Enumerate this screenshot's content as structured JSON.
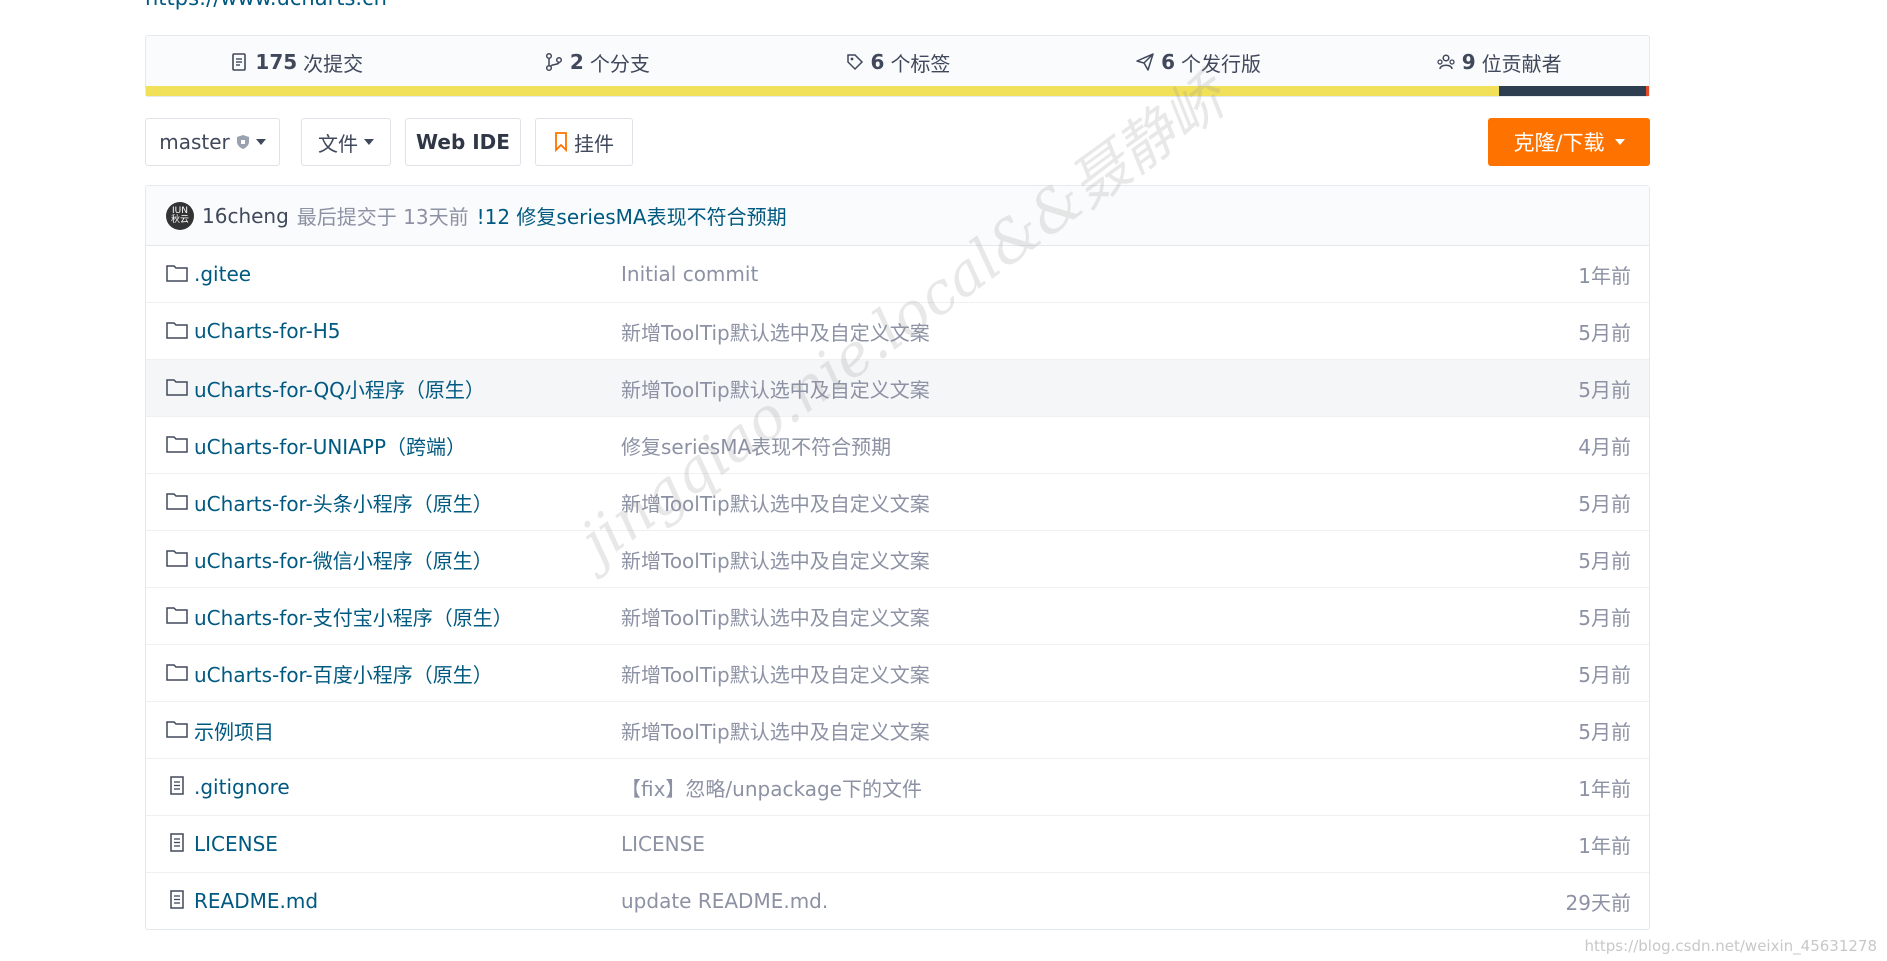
{
  "repo_url": "https://www.ucharts.cn",
  "summary": {
    "commits": {
      "count": "175",
      "label": "次提交",
      "icon": "commit-icon"
    },
    "branches": {
      "count": "2",
      "label": "个分支",
      "icon": "branch-icon"
    },
    "tags": {
      "count": "6",
      "label": "个标签",
      "icon": "tag-icon"
    },
    "releases": {
      "count": "6",
      "label": "个发行版",
      "icon": "release-icon"
    },
    "contributors": {
      "count": "9",
      "label": "位贡献者",
      "icon": "contributors-icon"
    }
  },
  "languages": [
    {
      "color": "#f1e05a",
      "fraction": 0.9
    },
    {
      "color": "#2c3e50",
      "fraction": 0.098
    },
    {
      "color": "#e34c26",
      "fraction": 0.002
    }
  ],
  "toolbar": {
    "branch": "master",
    "files": "文件",
    "webide": "Web IDE",
    "widget": "挂件",
    "clone": "克隆/下载"
  },
  "commit": {
    "avatar_text_1": "IUN",
    "avatar_text_2": "秋云",
    "author": "16cheng",
    "meta": "最后提交于 13天前",
    "message": "!12 修复seriesMA表现不符合预期"
  },
  "files": [
    {
      "type": "folder",
      "name": ".gitee",
      "message": "Initial commit",
      "time": "1年前"
    },
    {
      "type": "folder",
      "name": "uCharts-for-H5",
      "message": "新增ToolTip默认选中及自定义文案",
      "time": "5月前"
    },
    {
      "type": "folder",
      "name": "uCharts-for-QQ小程序（原生）",
      "message": "新增ToolTip默认选中及自定义文案",
      "time": "5月前"
    },
    {
      "type": "folder",
      "name": "uCharts-for-UNIAPP（跨端）",
      "message": "修复seriesMA表现不符合预期",
      "time": "4月前"
    },
    {
      "type": "folder",
      "name": "uCharts-for-头条小程序（原生）",
      "message": "新增ToolTip默认选中及自定义文案",
      "time": "5月前"
    },
    {
      "type": "folder",
      "name": "uCharts-for-微信小程序（原生）",
      "message": "新增ToolTip默认选中及自定义文案",
      "time": "5月前"
    },
    {
      "type": "folder",
      "name": "uCharts-for-支付宝小程序（原生）",
      "message": "新增ToolTip默认选中及自定义文案",
      "time": "5月前"
    },
    {
      "type": "folder",
      "name": "uCharts-for-百度小程序（原生）",
      "message": "新增ToolTip默认选中及自定义文案",
      "time": "5月前"
    },
    {
      "type": "folder",
      "name": "示例项目",
      "message": "新增ToolTip默认选中及自定义文案",
      "time": "5月前"
    },
    {
      "type": "file",
      "name": ".gitignore",
      "message": "【fix】忽略/unpackage下的文件",
      "time": "1年前"
    },
    {
      "type": "file",
      "name": "LICENSE",
      "message": "LICENSE",
      "time": "1年前"
    },
    {
      "type": "file",
      "name": "README.md",
      "message": "update README.md.",
      "time": "29天前"
    }
  ],
  "watermark": "jingqiao.nie.local&&聂静峤",
  "footer_url": "https://blog.csdn.net/weixin_45631278"
}
